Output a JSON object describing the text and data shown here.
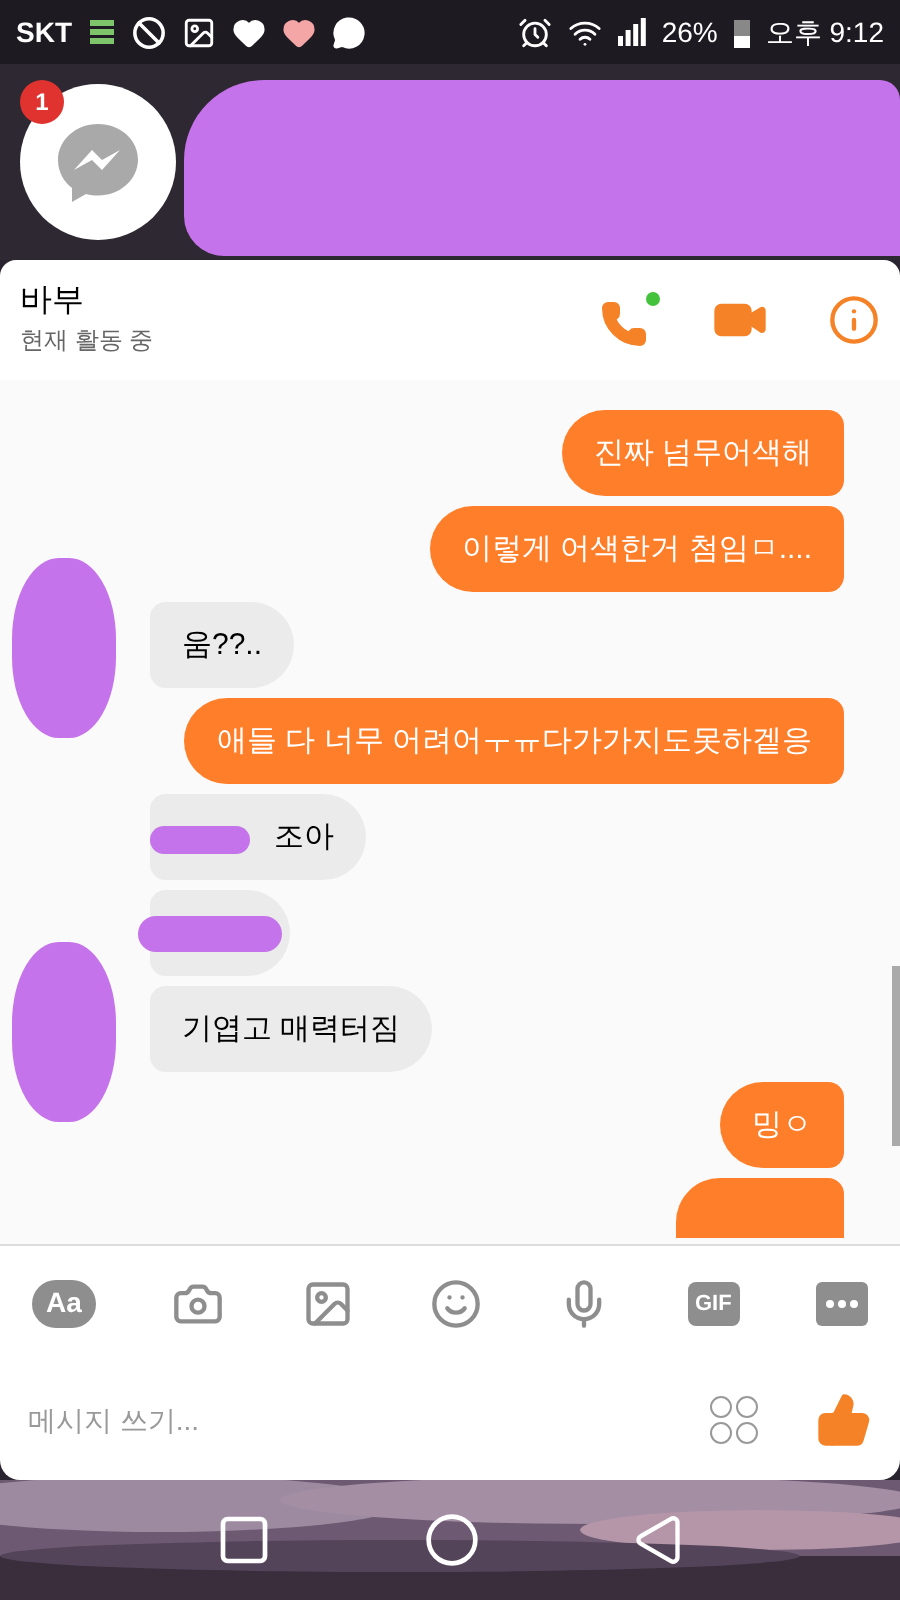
{
  "status_bar": {
    "carrier": "SKT",
    "battery": "26%",
    "time": "오후 9:12"
  },
  "chat_head": {
    "badge": "1"
  },
  "header": {
    "name": "바부",
    "status": "현재 활동 중",
    "online": true
  },
  "messages": [
    {
      "outgoing": true,
      "kind": "text",
      "text": "진짜 넘무어색해"
    },
    {
      "outgoing": true,
      "kind": "text",
      "text": "이렇게 어색한거 첨임ㅁ...."
    },
    {
      "outgoing": false,
      "kind": "text",
      "text": "움??..",
      "avatar": true
    },
    {
      "outgoing": true,
      "kind": "text",
      "text": "애들 다 너무 어려어ㅜㅠ다가가지도못하겥응"
    },
    {
      "outgoing": false,
      "kind": "redacted_prefix",
      "text": "조아"
    },
    {
      "outgoing": false,
      "kind": "redacted"
    },
    {
      "outgoing": false,
      "kind": "text",
      "text": "기엽고 매력터짐",
      "avatar": true
    },
    {
      "outgoing": true,
      "kind": "text",
      "text": "밍ㅇ"
    },
    {
      "outgoing": true,
      "kind": "cut"
    }
  ],
  "composer": {
    "format_button": "Aa",
    "gif_button": "GIF",
    "placeholder": "메시지 쓰기..."
  }
}
